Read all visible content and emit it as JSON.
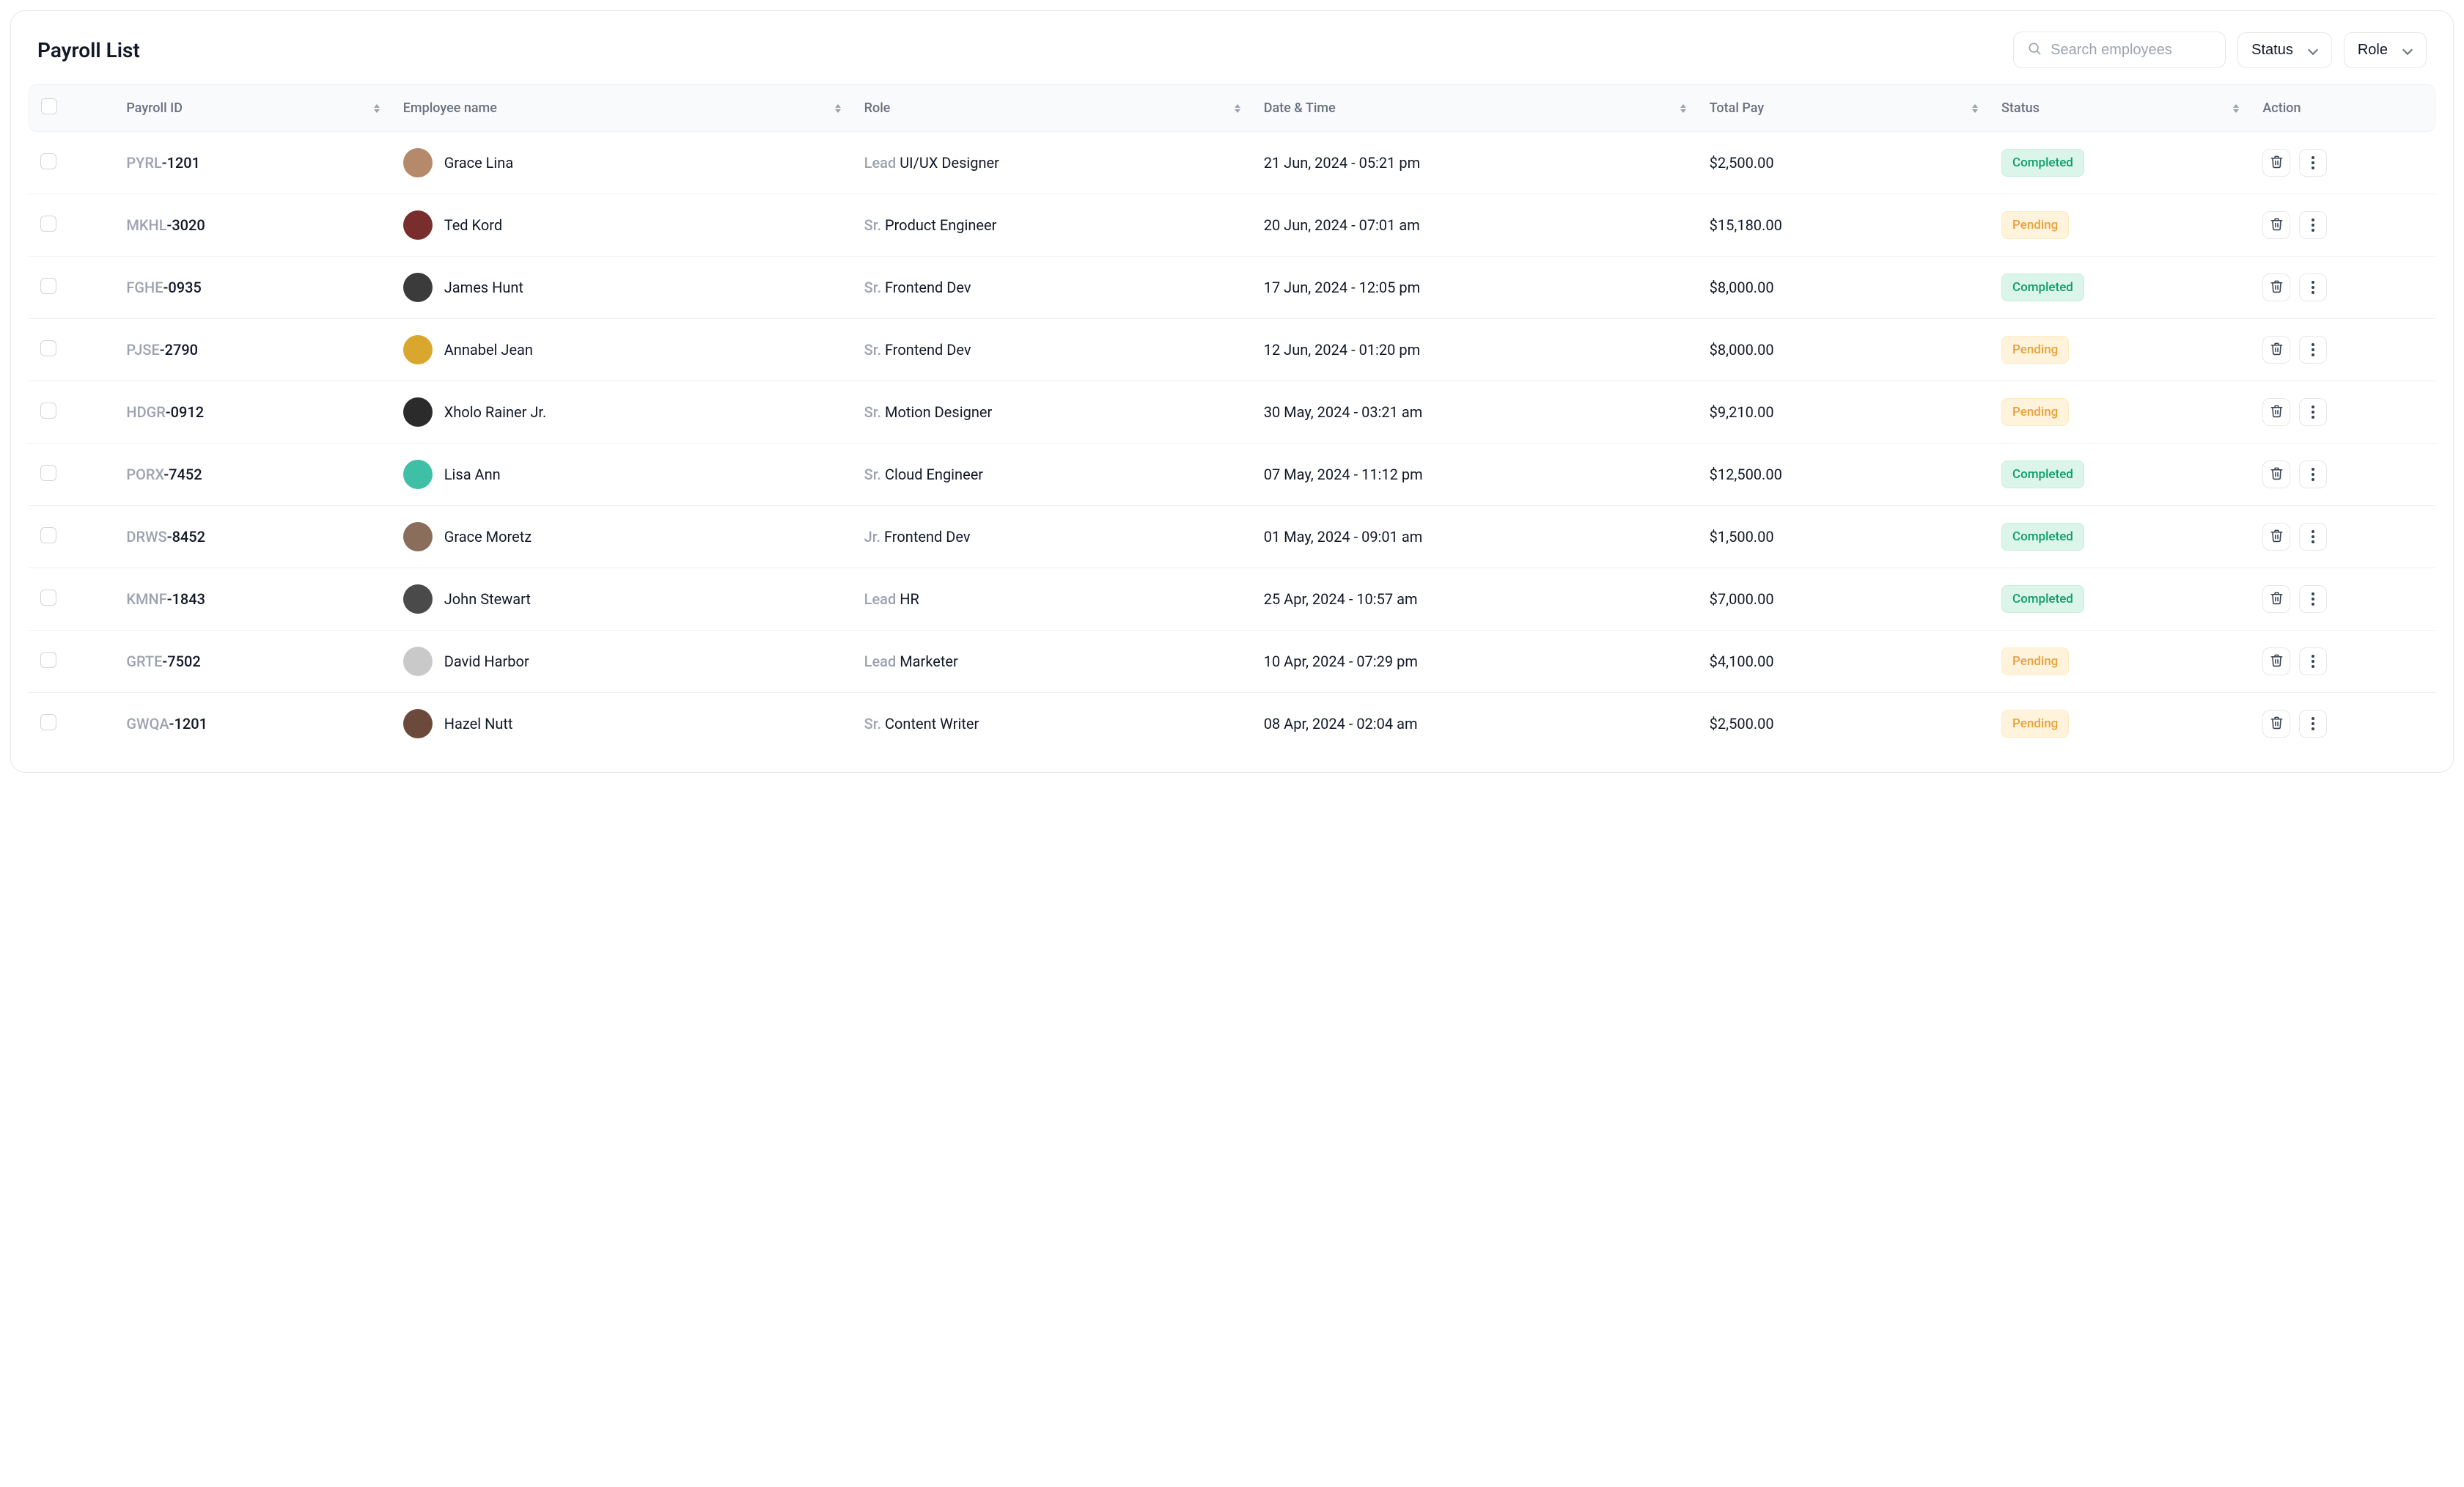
{
  "header": {
    "title": "Payroll List",
    "search_placeholder": "Search employees",
    "status_filter_label": "Status",
    "role_filter_label": "Role"
  },
  "columns": {
    "checkbox": "",
    "payroll_id": "Payroll ID",
    "employee_name": "Employee name",
    "role": "Role",
    "date_time": "Date & Time",
    "total_pay": "Total Pay",
    "status": "Status",
    "action": "Action"
  },
  "status_labels": {
    "completed": "Completed",
    "pending": "Pending"
  },
  "avatar_colors": [
    "#b48a6b",
    "#7a2d2d",
    "#3b3b3b",
    "#d9a62e",
    "#2b2b2b",
    "#3fbfa5",
    "#8a6d5a",
    "#4a4a4a",
    "#c9c9c9",
    "#6b4a3b"
  ],
  "rows": [
    {
      "pid_prefix": "PYRL",
      "pid_num": "-1201",
      "name": "Grace Lina",
      "role_prefix": "Lead",
      "role_rest": "UI/UX Designer",
      "date": "21 Jun, 2024 - 05:21 pm",
      "pay": "$2,500.00",
      "status": "completed"
    },
    {
      "pid_prefix": "MKHL",
      "pid_num": "-3020",
      "name": "Ted Kord",
      "role_prefix": "Sr.",
      "role_rest": "Product Engineer",
      "date": "20 Jun, 2024 - 07:01 am",
      "pay": "$15,180.00",
      "status": "pending"
    },
    {
      "pid_prefix": "FGHE",
      "pid_num": "-0935",
      "name": "James Hunt",
      "role_prefix": "Sr.",
      "role_rest": "Frontend Dev",
      "date": "17 Jun, 2024 - 12:05 pm",
      "pay": "$8,000.00",
      "status": "completed"
    },
    {
      "pid_prefix": "PJSE",
      "pid_num": "-2790",
      "name": "Annabel Jean",
      "role_prefix": "Sr.",
      "role_rest": "Frontend Dev",
      "date": "12 Jun, 2024 - 01:20 pm",
      "pay": "$8,000.00",
      "status": "pending"
    },
    {
      "pid_prefix": "HDGR",
      "pid_num": "-0912",
      "name": "Xholo Rainer Jr.",
      "role_prefix": "Sr.",
      "role_rest": "Motion Designer",
      "date": "30 May, 2024 - 03:21 am",
      "pay": "$9,210.00",
      "status": "pending"
    },
    {
      "pid_prefix": "PORX",
      "pid_num": "-7452",
      "name": "Lisa Ann",
      "role_prefix": "Sr.",
      "role_rest": "Cloud Engineer",
      "date": "07 May, 2024 - 11:12 pm",
      "pay": "$12,500.00",
      "status": "completed"
    },
    {
      "pid_prefix": "DRWS",
      "pid_num": "-8452",
      "name": "Grace Moretz",
      "role_prefix": "Jr.",
      "role_rest": "Frontend Dev",
      "date": "01 May, 2024 - 09:01 am",
      "pay": "$1,500.00",
      "status": "completed"
    },
    {
      "pid_prefix": "KMNF",
      "pid_num": "-1843",
      "name": "John Stewart",
      "role_prefix": "Lead",
      "role_rest": "HR",
      "date": "25 Apr, 2024 - 10:57 am",
      "pay": "$7,000.00",
      "status": "completed"
    },
    {
      "pid_prefix": "GRTE",
      "pid_num": "-7502",
      "name": "David Harbor",
      "role_prefix": "Lead",
      "role_rest": "Marketer",
      "date": "10 Apr, 2024 - 07:29 pm",
      "pay": "$4,100.00",
      "status": "pending"
    },
    {
      "pid_prefix": "GWQA",
      "pid_num": "-1201",
      "name": "Hazel Nutt",
      "role_prefix": "Sr.",
      "role_rest": "Content Writer",
      "date": "08 Apr, 2024 - 02:04 am",
      "pay": "$2,500.00",
      "status": "pending"
    }
  ]
}
